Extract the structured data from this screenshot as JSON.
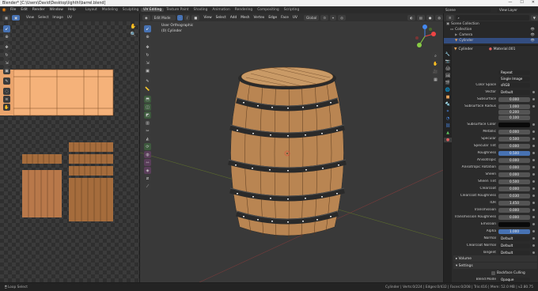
{
  "window": {
    "title": "Blender* [C:\\Users\\David\\Desktop\\lighthl\\barrel.blend]",
    "minimize": "—",
    "maximize": "☐",
    "close": "✕"
  },
  "menus": [
    "File",
    "Edit",
    "Render",
    "Window",
    "Help"
  ],
  "workspaces": [
    "Layout",
    "Modeling",
    "Sculpting",
    "UV Editing",
    "Texture Paint",
    "Shading",
    "Animation",
    "Rendering",
    "Compositing",
    "Scripting"
  ],
  "active_workspace": "UV Editing",
  "scene": {
    "scene_label": "Scene",
    "view_layer": "View Layer"
  },
  "uv_editor": {
    "menus": [
      "View",
      "Select",
      "Image",
      "UV"
    ]
  },
  "viewport": {
    "mode": "Edit Mode",
    "menus": [
      "View",
      "Select",
      "Add",
      "Mesh",
      "Vertex",
      "Edge",
      "Face",
      "UV"
    ],
    "transform": "Global",
    "overlay_title": "User Orthographic",
    "overlay_object": "(0) Cylinder"
  },
  "outliner": {
    "items": [
      {
        "label": "Scene Collection"
      },
      {
        "label": "Collection"
      },
      {
        "label": "Camera"
      },
      {
        "label": "Cylinder"
      }
    ]
  },
  "properties": {
    "object": "Cylinder",
    "material": "Material.001",
    "rows": [
      {
        "label": "",
        "value": "Repeat",
        "kind": "drop"
      },
      {
        "label": "",
        "value": "Single Image",
        "kind": "drop"
      },
      {
        "label": "Color Space",
        "value": "sRGB",
        "kind": "drop"
      },
      {
        "label": "Vector",
        "value": "Default",
        "kind": "plain"
      },
      {
        "label": "Subsurface",
        "value": "0.000",
        "kind": "num"
      },
      {
        "label": "Subsurface Radius",
        "value": "1.000",
        "kind": "num"
      },
      {
        "label": "",
        "value": "0.200",
        "kind": "num"
      },
      {
        "label": "",
        "value": "0.100",
        "kind": "num"
      },
      {
        "label": "Subsurface Color",
        "value": "",
        "kind": "black"
      },
      {
        "label": "Metallic",
        "value": "0.000",
        "kind": "num"
      },
      {
        "label": "Specular",
        "value": "0.500",
        "kind": "num"
      },
      {
        "label": "Specular Tint",
        "value": "0.000",
        "kind": "num"
      },
      {
        "label": "Roughness",
        "value": "0.500",
        "kind": "blue"
      },
      {
        "label": "Anisotropic",
        "value": "0.000",
        "kind": "num"
      },
      {
        "label": "Anisotropic Rotation",
        "value": "0.000",
        "kind": "num"
      },
      {
        "label": "Sheen",
        "value": "0.000",
        "kind": "num"
      },
      {
        "label": "Sheen Tint",
        "value": "0.500",
        "kind": "num"
      },
      {
        "label": "Clearcoat",
        "value": "0.000",
        "kind": "num"
      },
      {
        "label": "Clearcoat Roughness",
        "value": "0.030",
        "kind": "num"
      },
      {
        "label": "IOR",
        "value": "1.450",
        "kind": "num"
      },
      {
        "label": "Transmission",
        "value": "0.000",
        "kind": "num"
      },
      {
        "label": "Transmission Roughness",
        "value": "0.000",
        "kind": "num"
      },
      {
        "label": "Emission",
        "value": "",
        "kind": "black"
      },
      {
        "label": "Alpha",
        "value": "1.000",
        "kind": "blue"
      },
      {
        "label": "Normal",
        "value": "Default",
        "kind": "plain"
      },
      {
        "label": "Clearcoat Normal",
        "value": "Default",
        "kind": "plain"
      },
      {
        "label": "Tangent",
        "value": "Default",
        "kind": "plain"
      }
    ],
    "sections": [
      {
        "label": "Volume"
      },
      {
        "label": "Settings"
      }
    ],
    "backface_culling": "Backface Culling",
    "blend_mode_label": "Blend Mode",
    "blend_mode_value": "Opaque"
  },
  "status_bar": {
    "left": "Loop Select",
    "right": "Cylinder | Verts:0/224 | Edges:0/432 | Faces:0/208 | Tris:416 | Mem: 52.0 MB | v2.80.75"
  },
  "colors": {
    "accent": "#4772b3",
    "selected_row": "#334d80",
    "wood": "#b98552",
    "uv_wood": "#f5b27a"
  }
}
